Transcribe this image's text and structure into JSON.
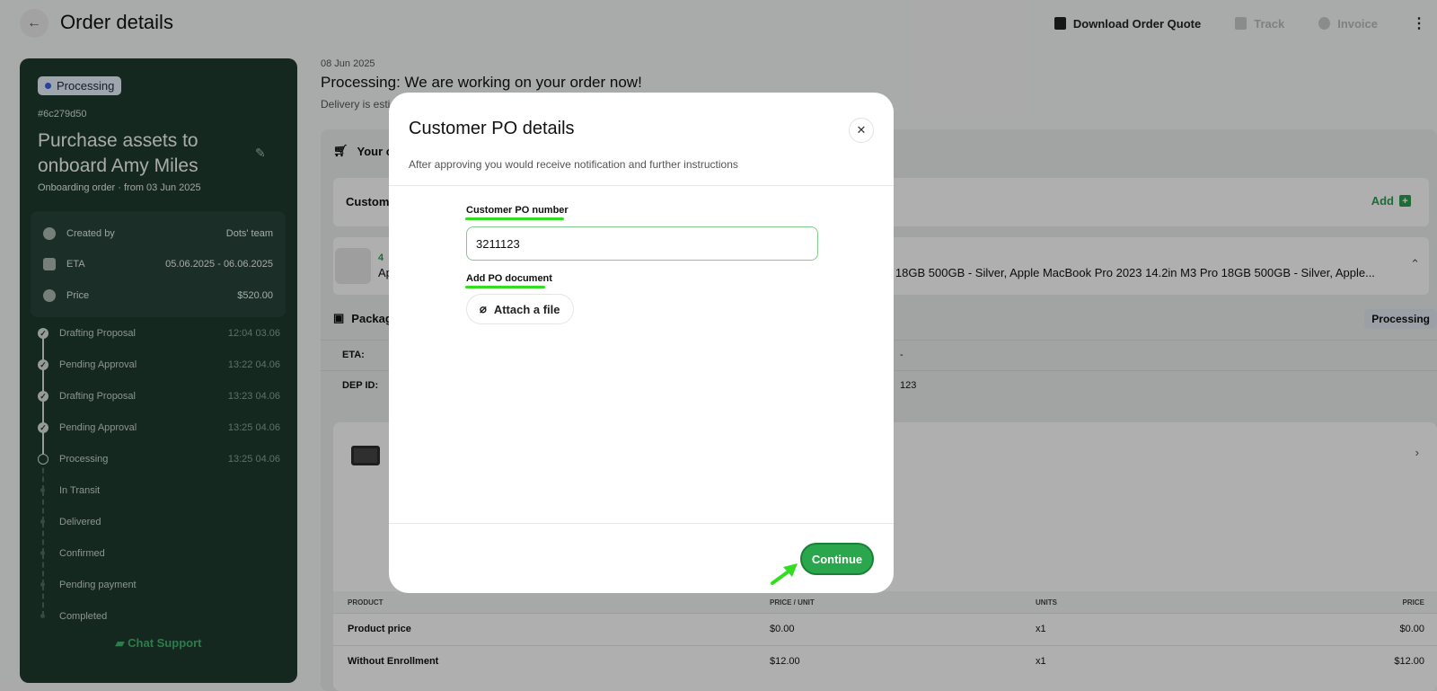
{
  "header": {
    "back_icon": "arrow-left-icon",
    "title": "Order details",
    "actions": [
      {
        "label": "Download Order Quote",
        "icon": "document-icon",
        "enabled": true
      },
      {
        "label": "Track",
        "icon": "track-icon",
        "enabled": false
      },
      {
        "label": "Invoice",
        "icon": "info-circle-icon",
        "enabled": false
      }
    ],
    "more_icon": "more-vertical-icon"
  },
  "sidebar": {
    "status": "Processing",
    "order_id": "#6c279d50",
    "title": "Purchase assets to onboard Amy Miles",
    "subtitle": "Onboarding order · from 03 Jun 2025",
    "info": [
      {
        "icon": "user-icon",
        "label": "Created by",
        "value": "Dots' team"
      },
      {
        "icon": "calendar-icon",
        "label": "ETA",
        "value": "05.06.2025 - 06.06.2025"
      },
      {
        "icon": "dollar-icon",
        "label": "Price",
        "value": "$520.00"
      }
    ],
    "timeline": [
      {
        "label": "Drafting Proposal",
        "time": "12:04 03.06",
        "state": "done"
      },
      {
        "label": "Pending Approval",
        "time": "13:22 04.06",
        "state": "done"
      },
      {
        "label": "Drafting Proposal",
        "time": "13:23 04.06",
        "state": "done"
      },
      {
        "label": "Pending Approval",
        "time": "13:25 04.06",
        "state": "done"
      },
      {
        "label": "Processing",
        "time": "13:25 04.06",
        "state": "current"
      },
      {
        "label": "In Transit",
        "time": "",
        "state": "future"
      },
      {
        "label": "Delivered",
        "time": "",
        "state": "future"
      },
      {
        "label": "Confirmed",
        "time": "",
        "state": "future"
      },
      {
        "label": "Pending payment",
        "time": "",
        "state": "future"
      },
      {
        "label": "Completed",
        "time": "",
        "state": "future"
      }
    ],
    "chat_support": "Chat Support"
  },
  "main": {
    "date": "08 Jun 2025",
    "headline": "Processing: We are working on your order now!",
    "delivery_text": "Delivery is esti",
    "panel_head": "Your o",
    "customer_label": "Custome",
    "add_label": "Add",
    "items_count": "4",
    "items_text_prefix": "Ap",
    "items_text": "18GB 500GB - Silver, Apple MacBook Pro 2023 14.2in M3 Pro 18GB 500GB - Silver, Apple...",
    "package_label": "Packag",
    "package_status": "Processing",
    "eta_label": "ETA:",
    "eta_value": "-",
    "dep_label": "DEP ID:",
    "dep_value": "123",
    "table": {
      "headers": [
        "PRODUCT",
        "PRICE / UNIT",
        "UNITS",
        "PRICE"
      ],
      "rows": [
        [
          "Product price",
          "$0.00",
          "x1",
          "$0.00"
        ],
        [
          "Without Enrollment",
          "$12.00",
          "x1",
          "$12.00"
        ]
      ]
    }
  },
  "modal": {
    "title": "Customer PO details",
    "subtitle": "After approving you would receive notification and further instructions",
    "po_label": "Customer PO number",
    "po_value": "3211123",
    "doc_label": "Add PO document",
    "attach_label": "Attach a file",
    "continue_label": "Continue",
    "close_icon": "close-icon",
    "annotation_color": "#33dd22"
  }
}
